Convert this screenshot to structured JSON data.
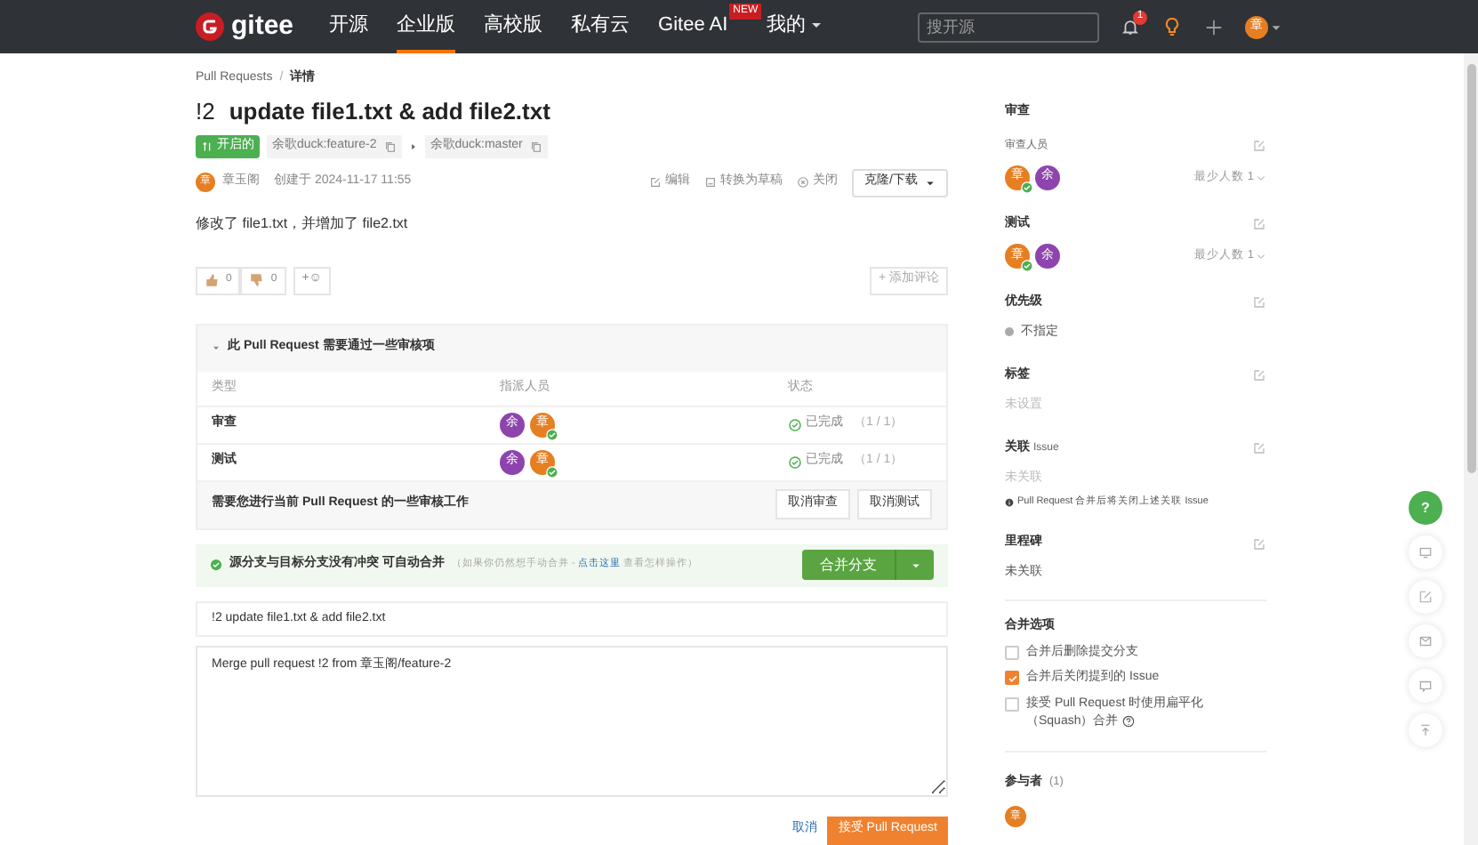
{
  "navbar": {
    "logo": "gitee",
    "items": [
      {
        "label": "开源",
        "selected": false
      },
      {
        "label": "企业版",
        "selected": true
      },
      {
        "label": "高校版",
        "selected": false
      },
      {
        "label": "私有云",
        "selected": false
      },
      {
        "label": "Gitee AI",
        "selected": false,
        "badge": "NEW"
      },
      {
        "label": "我的",
        "selected": false,
        "dropdown": true
      }
    ],
    "search": {
      "placeholder": "搜开源"
    },
    "notification_count": "1",
    "user_initial": "章"
  },
  "breadcrumb": [
    "Pull Requests",
    "详情"
  ],
  "breadcrumb_separator": "/",
  "title": {
    "number": "!2",
    "text": "update file1.txt & add file2.txt"
  },
  "status_badge": "开启的",
  "source_branch": "余歌duck:feature-2",
  "target_branch": "余歌duck:master",
  "author": {
    "initial": "章",
    "name": "章玉阁",
    "created": "创建于 2024-11-17 11:55"
  },
  "actions": [
    "编辑",
    "转换为草稿",
    "关闭"
  ],
  "clone_button": "克隆/下载",
  "description": "修改了 file1.txt，并增加了 file2.txt",
  "reactions": [
    {
      "kind": "thumbs-up",
      "count": "0"
    },
    {
      "kind": "thumbs-down",
      "count": "0"
    }
  ],
  "emoji_button": "+☺",
  "add_comment": "+ 添加评论",
  "review": {
    "header": "此 Pull Request 需要通过一些审核项",
    "expanded": true,
    "columns": [
      "类型",
      "指派人员",
      "状态"
    ],
    "rows": [
      {
        "type": "审查",
        "assignees": [
          {
            "initial": "余",
            "color": "#8e44ad",
            "approved": false
          },
          {
            "initial": "章",
            "color": "#e67e22",
            "approved": true
          }
        ],
        "status": "已完成",
        "progress": "（1 / 1）"
      },
      {
        "type": "测试",
        "assignees": [
          {
            "initial": "余",
            "color": "#8e44ad",
            "approved": false
          },
          {
            "initial": "章",
            "color": "#e67e22",
            "approved": true
          }
        ],
        "status": "已完成",
        "progress": "（1 / 1）"
      }
    ],
    "footer": "需要您进行当前 Pull Request 的一些审核工作",
    "buttons": [
      "取消审查",
      "取消测试"
    ]
  },
  "merge": {
    "message": "源分支与目标分支没有冲突 可自动合并",
    "hint_before": "（如果你仍然想手动合并 -",
    "hint_link": "点击这里",
    "hint_after": "查看怎样操作）",
    "button": "合并分支",
    "commit_title": "!2 update file1.txt & add file2.txt",
    "commit_body": "Merge pull request !2 from 章玉阁/feature-2",
    "cancel": "取消",
    "accept": "接受 Pull Request"
  },
  "sidebar": {
    "review": {
      "title": "审查",
      "subtitle": "审查人员",
      "assignees": [
        {
          "initial": "章",
          "color": "#e67e22",
          "approved": true
        },
        {
          "initial": "余",
          "color": "#8e44ad",
          "approved": false
        }
      ],
      "minimum": "最少人数 1"
    },
    "test": {
      "title": "测试",
      "assignees": [
        {
          "initial": "章",
          "color": "#e67e22",
          "approved": true
        },
        {
          "initial": "余",
          "color": "#8e44ad",
          "approved": false
        }
      ],
      "minimum": "最少人数 1"
    },
    "priority": {
      "title": "优先级",
      "value": "不指定",
      "color": "#aaaaaa"
    },
    "labels": {
      "title": "标签",
      "value": "未设置"
    },
    "issue": {
      "title": "关联",
      "title_suffix": "Issue",
      "value": "未关联",
      "note": "Pull Request 合并后将关闭上述关联 Issue"
    },
    "milestone": {
      "title": "里程碑",
      "value": "未关联"
    },
    "merge_options": {
      "title": "合并选项",
      "options": [
        {
          "label": "合并后删除提交分支",
          "checked": false
        },
        {
          "label": "合并后关闭提到的 Issue",
          "checked": true
        },
        {
          "label": "接受 Pull Request 时使用扁平化（Squash）合并",
          "checked": false,
          "help": true
        }
      ]
    },
    "participants": {
      "title": "参与者",
      "count": "(1)",
      "people": [
        {
          "initial": "章",
          "color": "#e67e22"
        }
      ]
    }
  },
  "floating_help": "?"
}
